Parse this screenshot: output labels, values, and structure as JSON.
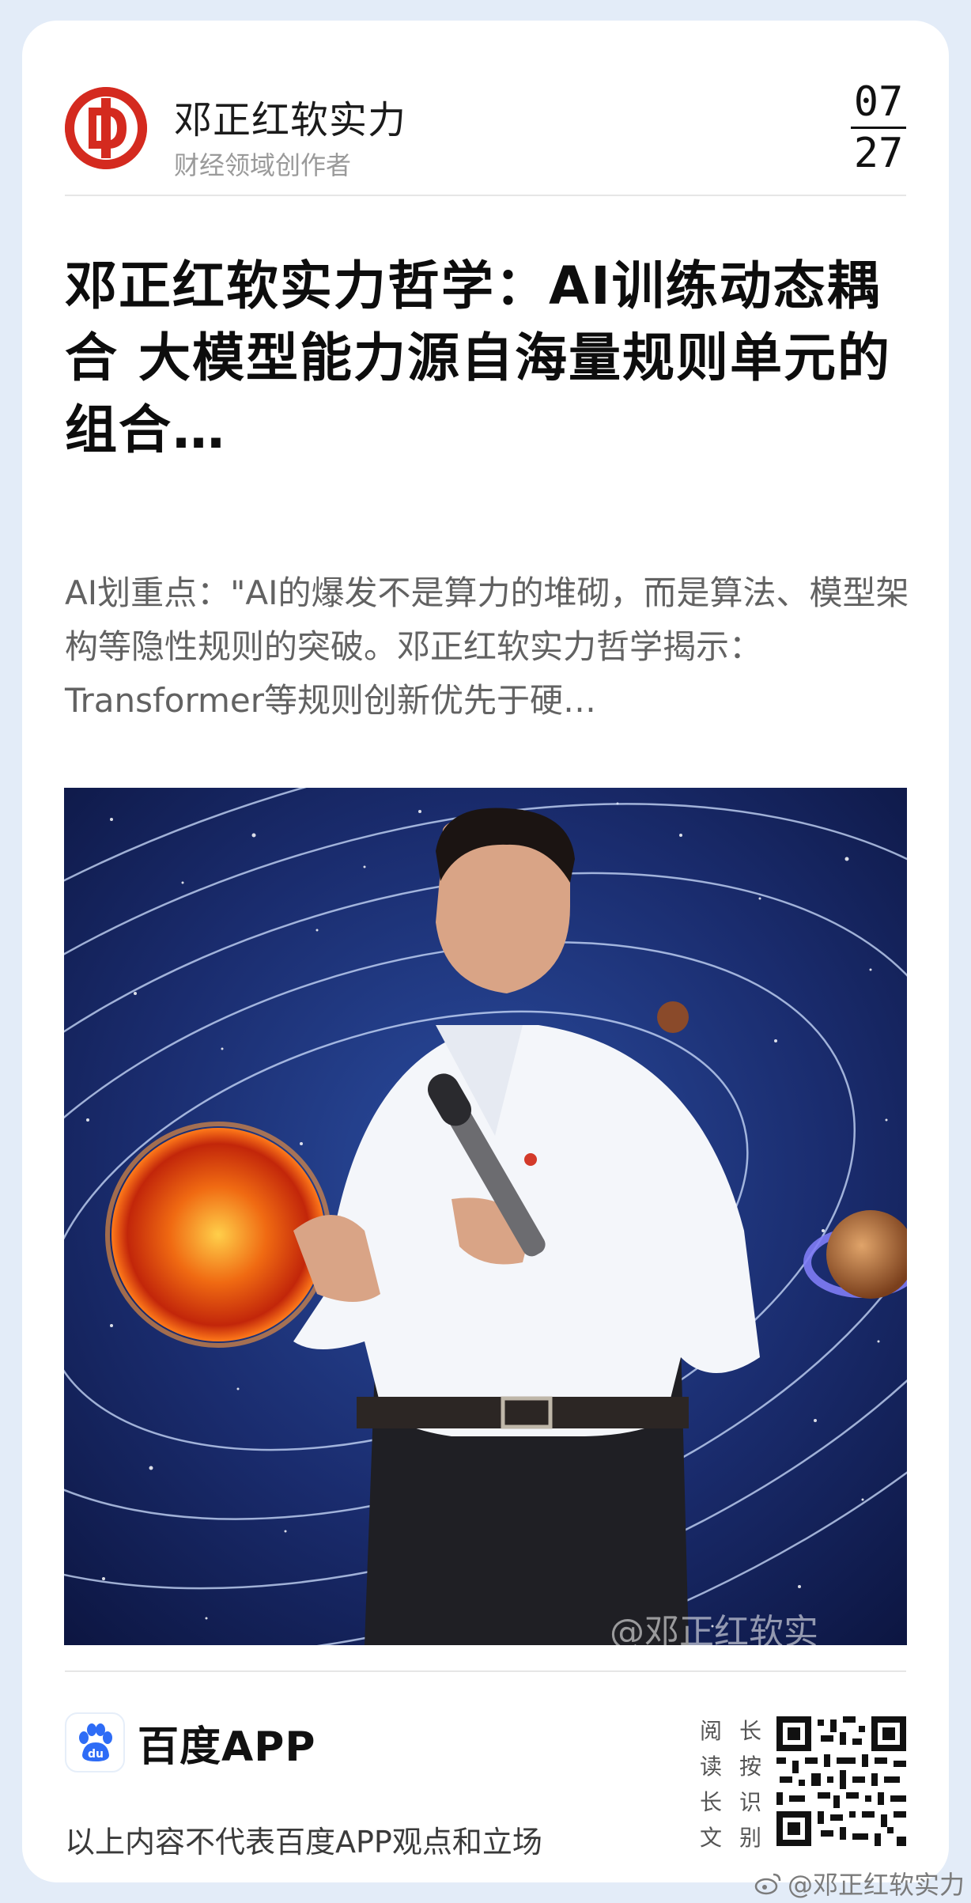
{
  "author": {
    "name": "邓正红软实力",
    "description": "财经领域创作者"
  },
  "date": {
    "month": "07",
    "day": "27"
  },
  "article": {
    "title": "邓正红软实力哲学：AI训练动态耦合 大模型能力源自海量规则单元的组合…",
    "summary": "AI划重点：\"AI的爆发不是算力的堆砌，而是算法、模型架构等隐性规则的突破。邓正红软实力哲学揭示：Transformer等规则创新优先于硬…",
    "image_watermark": "@邓正红软实"
  },
  "footer": {
    "app_name": "百度APP",
    "disclaimer": "以上内容不代表百度APP观点和立场",
    "longpress_chars": [
      "阅",
      "读",
      "长",
      "文",
      "长",
      "按",
      "识",
      "别"
    ]
  },
  "page_watermark": "@邓正红软实力",
  "colors": {
    "brand_red": "#d42a1f",
    "baidu_blue": "#2e6cf6",
    "background": "#e3ecf8"
  }
}
